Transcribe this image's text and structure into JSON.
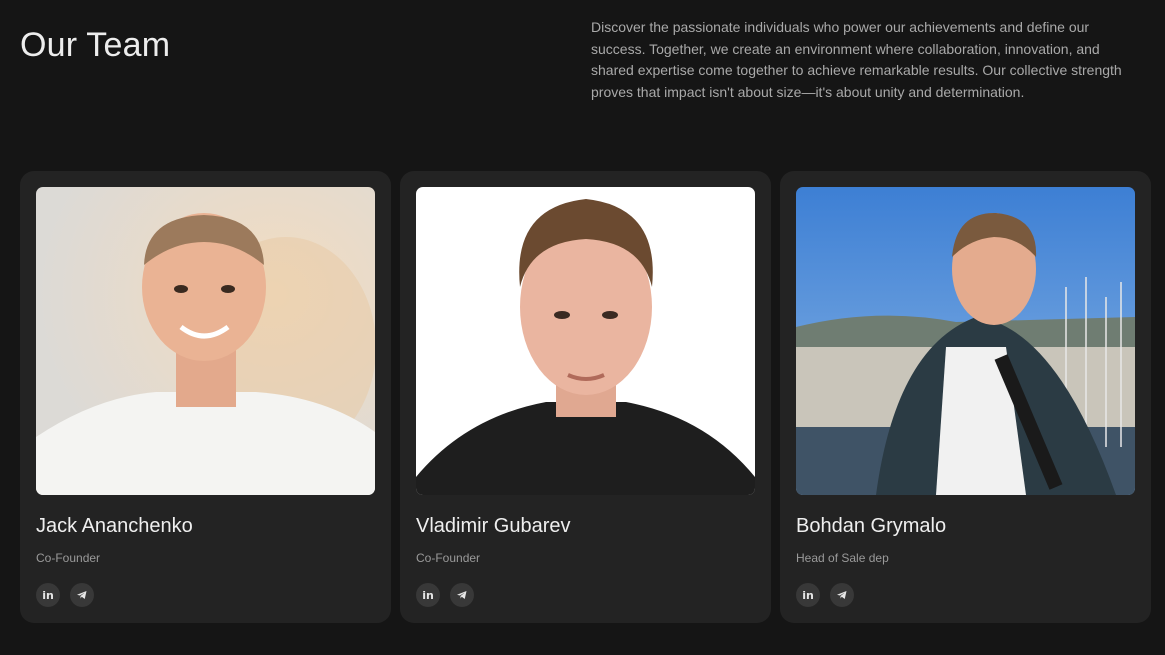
{
  "header": {
    "title": "Our Team",
    "description": "Discover the passionate individuals who power our achievements and define our success. Together, we create an environment where collaboration, innovation, and shared expertise come together to achieve remarkable results. Our collective strength proves that impact isn't about size—it's about unity and determination."
  },
  "members": [
    {
      "name": "Jack Ananchenko",
      "role": "Co-Founder",
      "linkedin_label": "in",
      "photo_icon": "portrait-photo"
    },
    {
      "name": "Vladimir Gubarev",
      "role": "Co-Founder",
      "linkedin_label": "in",
      "photo_icon": "portrait-photo"
    },
    {
      "name": "Bohdan Grymalo",
      "role": "Head of Sale dep",
      "linkedin_label": "in",
      "photo_icon": "portrait-photo"
    }
  ],
  "colors": {
    "background": "#151515",
    "card": "#232323",
    "social_bg": "#383838"
  }
}
